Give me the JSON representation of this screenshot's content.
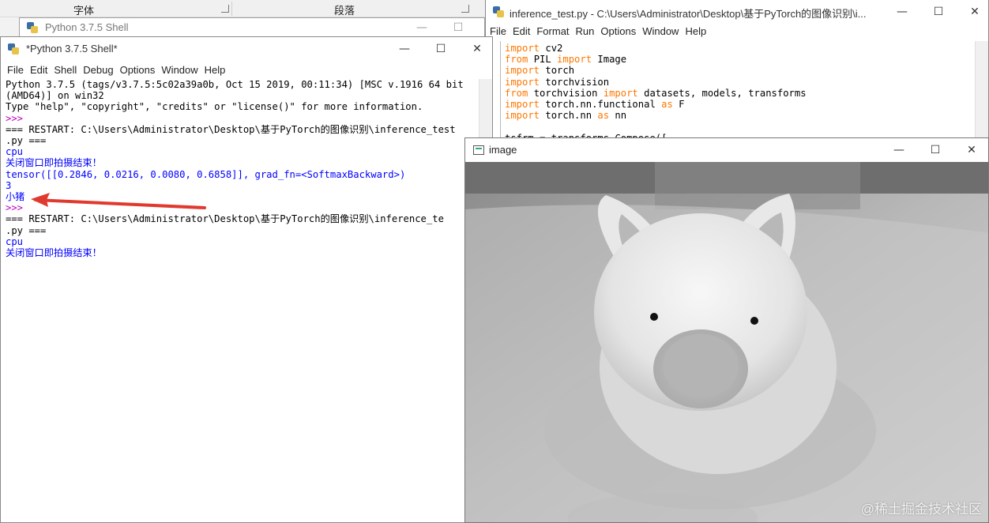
{
  "word_bg": {
    "label_font": "字体",
    "label_paragraph": "段落"
  },
  "shell_bg": {
    "title": "Python 3.7.5 Shell"
  },
  "shell": {
    "title": "*Python 3.7.5 Shell*",
    "menu": [
      "File",
      "Edit",
      "Shell",
      "Debug",
      "Options",
      "Window",
      "Help"
    ],
    "lines": [
      {
        "text": "Python 3.7.5 (tags/v3.7.5:5c02a39a0b, Oct 15 2019, 00:11:34) [MSC v.1916 64 bit",
        "style": "normal"
      },
      {
        "text": "(AMD64)] on win32",
        "style": "normal"
      },
      {
        "text": "Type \"help\", \"copyright\", \"credits\" or \"license()\" for more information.",
        "style": "normal"
      },
      {
        "text": ">>> ",
        "style": "prompt"
      },
      {
        "text": "=== RESTART: C:\\Users\\Administrator\\Desktop\\基于PyTorch的图像识别\\inference_test",
        "style": "normal"
      },
      {
        "text": ".py ===",
        "style": "normal"
      },
      {
        "text": "cpu",
        "style": "stdout"
      },
      {
        "text": "关闭窗口即拍摄结束！",
        "style": "stdout"
      },
      {
        "text": "tensor([[0.2846, 0.0216, 0.0080, 0.6858]], grad_fn=<SoftmaxBackward>)",
        "style": "stdout"
      },
      {
        "text": "3",
        "style": "stdout"
      },
      {
        "text": "小猪",
        "style": "stdout"
      },
      {
        "text": ">>> ",
        "style": "prompt"
      },
      {
        "text": "=== RESTART: C:\\Users\\Administrator\\Desktop\\基于PyTorch的图像识别\\inference_te",
        "style": "normal"
      },
      {
        "text": ".py ===",
        "style": "normal"
      },
      {
        "text": "cpu",
        "style": "stdout"
      },
      {
        "text": "关闭窗口即拍摄结束！",
        "style": "stdout"
      }
    ]
  },
  "editor": {
    "title": "inference_test.py - C:\\Users\\Administrator\\Desktop\\基于PyTorch的图像识别\\i...",
    "menu": [
      "File",
      "Edit",
      "Format",
      "Run",
      "Options",
      "Window",
      "Help"
    ],
    "code": [
      [
        {
          "t": "import",
          "k": true
        },
        {
          "t": " cv2"
        }
      ],
      [
        {
          "t": "from",
          "k": true
        },
        {
          "t": " PIL "
        },
        {
          "t": "import",
          "k": true
        },
        {
          "t": " Image"
        }
      ],
      [
        {
          "t": "import",
          "k": true
        },
        {
          "t": " torch"
        }
      ],
      [
        {
          "t": "import",
          "k": true
        },
        {
          "t": " torchvision"
        }
      ],
      [
        {
          "t": "from",
          "k": true
        },
        {
          "t": " torchvision "
        },
        {
          "t": "import",
          "k": true
        },
        {
          "t": " datasets, models, transforms"
        }
      ],
      [
        {
          "t": "import",
          "k": true
        },
        {
          "t": " torch.nn.functional "
        },
        {
          "t": "as",
          "k": true
        },
        {
          "t": " F"
        }
      ],
      [
        {
          "t": "import",
          "k": true
        },
        {
          "t": " torch.nn "
        },
        {
          "t": "as",
          "k": true
        },
        {
          "t": " nn"
        }
      ],
      [
        {
          "t": ""
        }
      ],
      [
        {
          "t": "tsfrm = transforms.Compose(["
        }
      ]
    ]
  },
  "image_window": {
    "title": "image"
  },
  "window_buttons": {
    "minimize": "—",
    "maximize": "☐",
    "close": "✕"
  },
  "watermark": "@稀土掘金技术社区",
  "colors": {
    "keyword": "#ff7700",
    "stdout": "#0000ff",
    "prompt": "#c000c0",
    "arrow": "#e03a2f"
  }
}
